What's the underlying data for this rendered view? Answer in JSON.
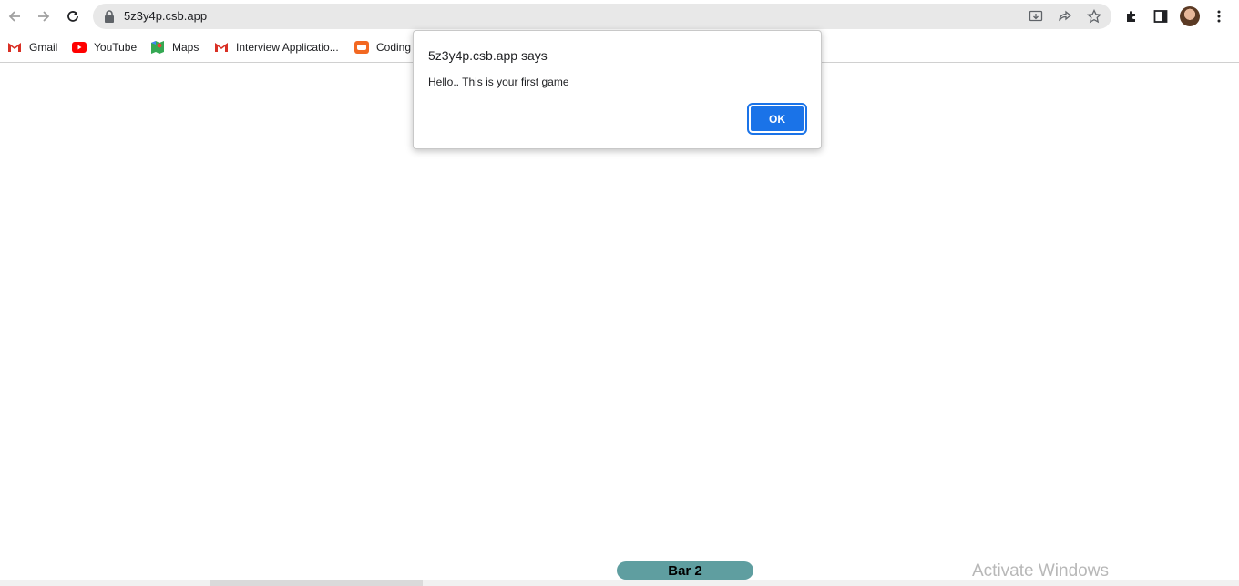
{
  "browser": {
    "url": "5z3y4p.csb.app"
  },
  "bookmarks": [
    {
      "label": "Gmail",
      "icon": "gmail-icon"
    },
    {
      "label": "YouTube",
      "icon": "youtube-icon"
    },
    {
      "label": "Maps",
      "icon": "maps-icon"
    },
    {
      "label": "Interview Applicatio...",
      "icon": "gmail-icon"
    },
    {
      "label": "Coding",
      "icon": "coding-icon"
    }
  ],
  "dialog": {
    "title": "5z3y4p.csb.app says",
    "message": "Hello.. This is your first game",
    "ok_label": "OK"
  },
  "page": {
    "bar_label": "Bar 2",
    "bar_color": "#5f9ea0"
  },
  "watermark": "Activate Windows",
  "colors": {
    "accent": "#1a73e8",
    "youtube": "#ff0000"
  }
}
